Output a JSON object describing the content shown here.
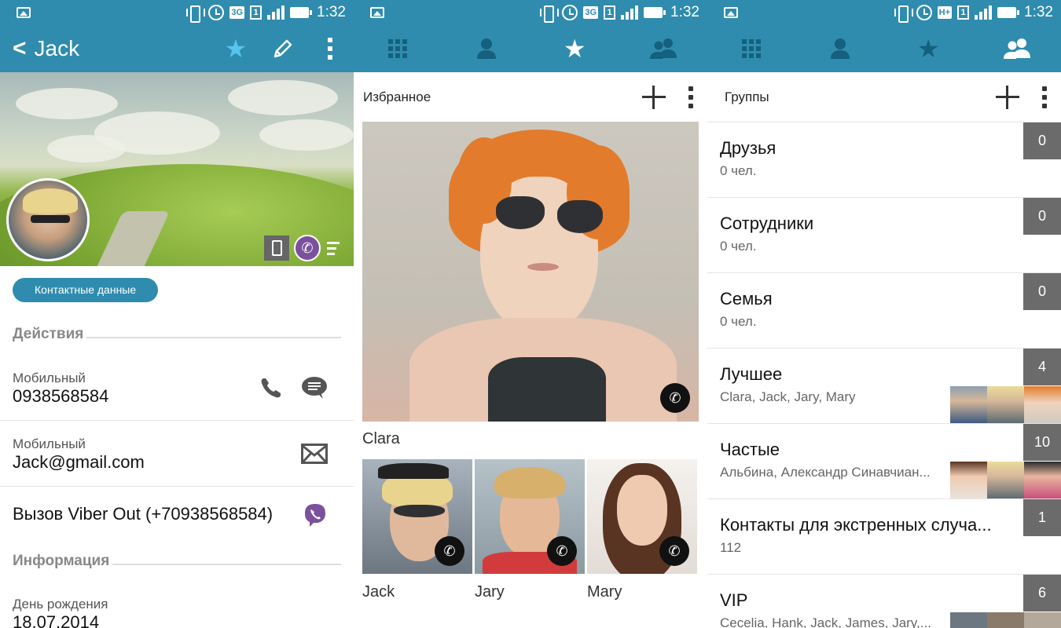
{
  "status_bar": {
    "time": "1:32",
    "network_left": "3G",
    "network_middle": "3G",
    "network_right": "H+",
    "sim": "1"
  },
  "contact": {
    "name": "Jack",
    "details_button": "Контактные данные",
    "actions_header": "Действия",
    "rows": [
      {
        "label": "Мобильный",
        "value": "0938568584"
      },
      {
        "label": "Мобильный",
        "value": "Jack@gmail.com"
      }
    ],
    "viber_out": "Вызов Viber Out (+70938568584)",
    "info_header": "Информация",
    "birthday_label": "День рождения",
    "birthday_value": "18.07.2014"
  },
  "favorites": {
    "title": "Избранное",
    "main_name": "Clara",
    "small": [
      {
        "name": "Jack"
      },
      {
        "name": "Jary"
      },
      {
        "name": "Mary"
      }
    ]
  },
  "groups": {
    "title": "Группы",
    "items": [
      {
        "name": "Друзья",
        "sub": "0 чел.",
        "count": "0"
      },
      {
        "name": "Сотрудники",
        "sub": "0 чел.",
        "count": "0"
      },
      {
        "name": "Семья",
        "sub": "0 чел.",
        "count": "0"
      },
      {
        "name": "Лучшее",
        "sub": "Clara, Jack, Jary, Mary",
        "count": "4"
      },
      {
        "name": "Частые",
        "sub": "Альбина, Александр Синавчиан...",
        "count": "10"
      },
      {
        "name": "Контакты для экстренных случа...",
        "sub": "112",
        "count": "1"
      },
      {
        "name": "VIP",
        "sub": "Cecelia, Hank, Jack, James, Jary,...",
        "count": "6"
      }
    ]
  },
  "colors": {
    "primary": "#2f8cae",
    "accent_star": "#56c4ef",
    "viber": "#7b519d",
    "count_badge": "#6b6b6b"
  }
}
